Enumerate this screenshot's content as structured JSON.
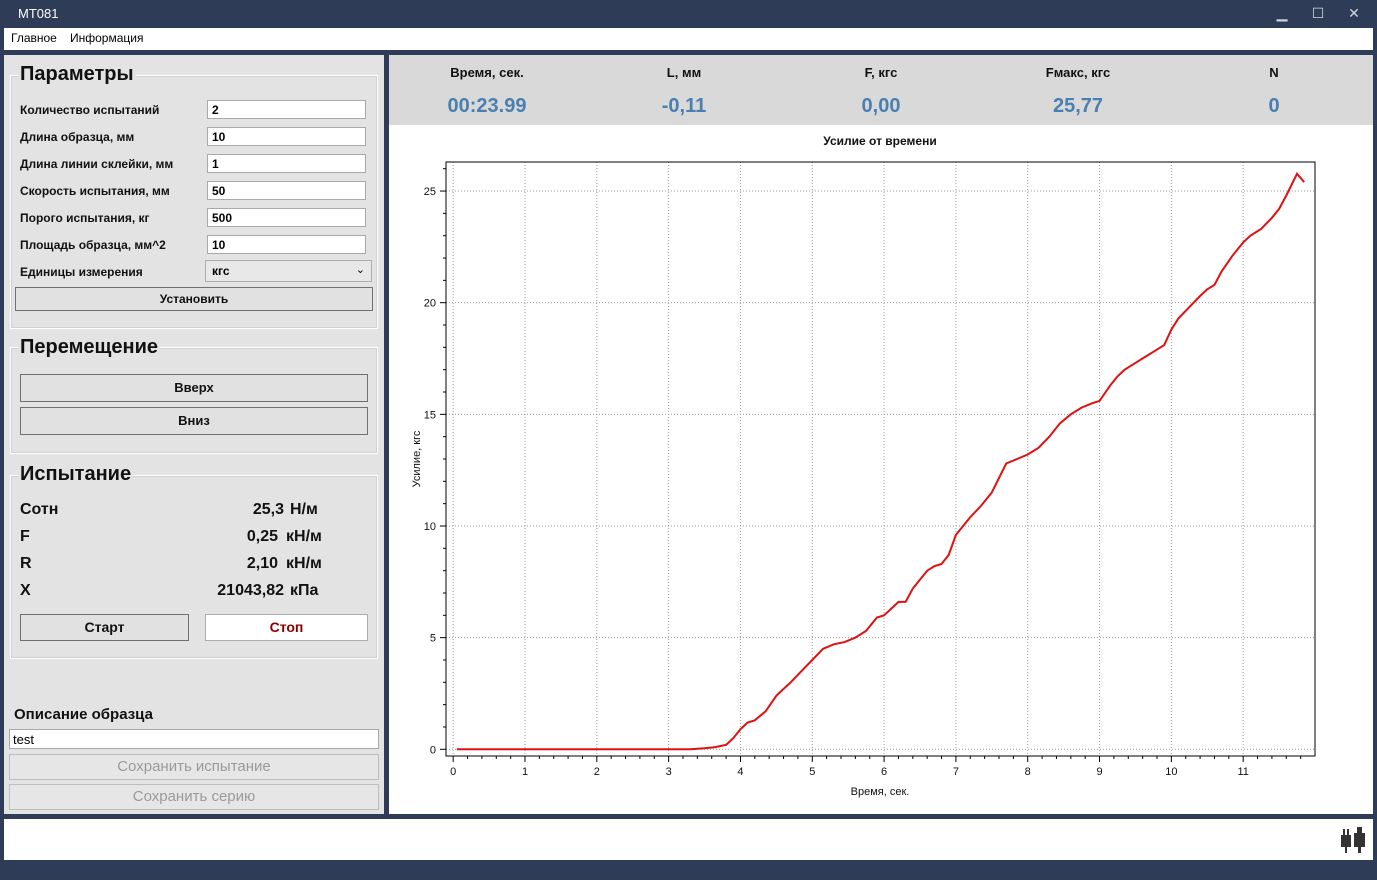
{
  "window": {
    "title": "MT081",
    "minimize": "▁",
    "maximize": "☐",
    "close": "✕"
  },
  "menu": {
    "items": [
      "Главное",
      "Информация"
    ]
  },
  "params": {
    "title": "Параметры",
    "rows": [
      {
        "label": "Количество испытаний",
        "value": "2"
      },
      {
        "label": "Длина образца, мм",
        "value": "10"
      },
      {
        "label": "Длина линии склейки, мм",
        "value": "1"
      },
      {
        "label": "Скорость испытания, мм",
        "value": "50"
      },
      {
        "label": "Порого испытания, кг",
        "value": "500"
      },
      {
        "label": "Площадь образца, мм^2",
        "value": "10"
      }
    ],
    "units_label": "Единицы измерения",
    "units_value": "кгс",
    "set_button": "Установить"
  },
  "move": {
    "title": "Перемещение",
    "up": "Вверх",
    "down": "Вниз"
  },
  "test": {
    "title": "Испытание",
    "rows": [
      {
        "label": "Сотн",
        "value": "25,3",
        "unit": "Н/м"
      },
      {
        "label": "F",
        "value": "0,25",
        "unit": "кН/м"
      },
      {
        "label": "R",
        "value": "2,10",
        "unit": "кН/м"
      },
      {
        "label": "X",
        "value": "21043,82",
        "unit": "кПа"
      }
    ],
    "start": "Старт",
    "stop": "Стоп",
    "stop_color": "#8b0000"
  },
  "description": {
    "label": "Описание образца",
    "value": "test",
    "save_test": "Сохранить испытание",
    "save_series": "Сохранить серию"
  },
  "readouts": [
    {
      "header": "Время, сек.",
      "value": "00:23.99"
    },
    {
      "header": "L, мм",
      "value": "-0,11"
    },
    {
      "header": "F, кгс",
      "value": "0,00"
    },
    {
      "header": "Fмакс, кгс",
      "value": "25,77"
    },
    {
      "header": "N",
      "value": "0"
    }
  ],
  "accent_color": "#4a7fb0",
  "chart_data": {
    "type": "line",
    "title": "Усилие от времени",
    "xlabel": "Время, сек.",
    "ylabel": "Усилие, кгс",
    "xlim": [
      -0.1,
      12
    ],
    "ylim": [
      -0.3,
      26.3
    ],
    "xticks": [
      0,
      1,
      2,
      3,
      4,
      5,
      6,
      7,
      8,
      9,
      10,
      11
    ],
    "yticks": [
      0,
      5,
      10,
      15,
      20,
      25
    ],
    "grid": true,
    "line_color": "#e01010",
    "series": [
      {
        "x": [
          0.05,
          1,
          2,
          3,
          3.3,
          3.5,
          3.65,
          3.8,
          3.9,
          4.0,
          4.1,
          4.2,
          4.35,
          4.5,
          4.6,
          4.7,
          4.85,
          5.0,
          5.15,
          5.3,
          5.45,
          5.6,
          5.75,
          5.9,
          6.0,
          6.1,
          6.2,
          6.3,
          6.4,
          6.5,
          6.6,
          6.7,
          6.8,
          6.9,
          7.0,
          7.1,
          7.2,
          7.35,
          7.5,
          7.7,
          7.85,
          8.0,
          8.15,
          8.3,
          8.45,
          8.6,
          8.75,
          8.9,
          9.0,
          9.15,
          9.25,
          9.35,
          9.55,
          9.75,
          9.9,
          10.0,
          10.1,
          10.25,
          10.4,
          10.5,
          10.6,
          10.7,
          10.85,
          11.0,
          11.1,
          11.25,
          11.4,
          11.5,
          11.6,
          11.75,
          11.85
        ],
        "y": [
          0,
          0,
          0,
          0,
          0,
          0.05,
          0.1,
          0.2,
          0.5,
          0.9,
          1.2,
          1.3,
          1.7,
          2.4,
          2.7,
          3.0,
          3.5,
          4.0,
          4.5,
          4.7,
          4.8,
          5.0,
          5.3,
          5.9,
          6.0,
          6.3,
          6.6,
          6.6,
          7.2,
          7.6,
          8.0,
          8.2,
          8.3,
          8.7,
          9.6,
          10.0,
          10.4,
          10.9,
          11.5,
          12.8,
          13.0,
          13.2,
          13.5,
          14.0,
          14.6,
          15.0,
          15.3,
          15.5,
          15.6,
          16.3,
          16.7,
          17.0,
          17.4,
          17.8,
          18.1,
          18.8,
          19.3,
          19.8,
          20.3,
          20.6,
          20.8,
          21.4,
          22.1,
          22.7,
          23.0,
          23.3,
          23.8,
          24.2,
          24.8,
          25.77,
          25.4
        ]
      }
    ]
  }
}
